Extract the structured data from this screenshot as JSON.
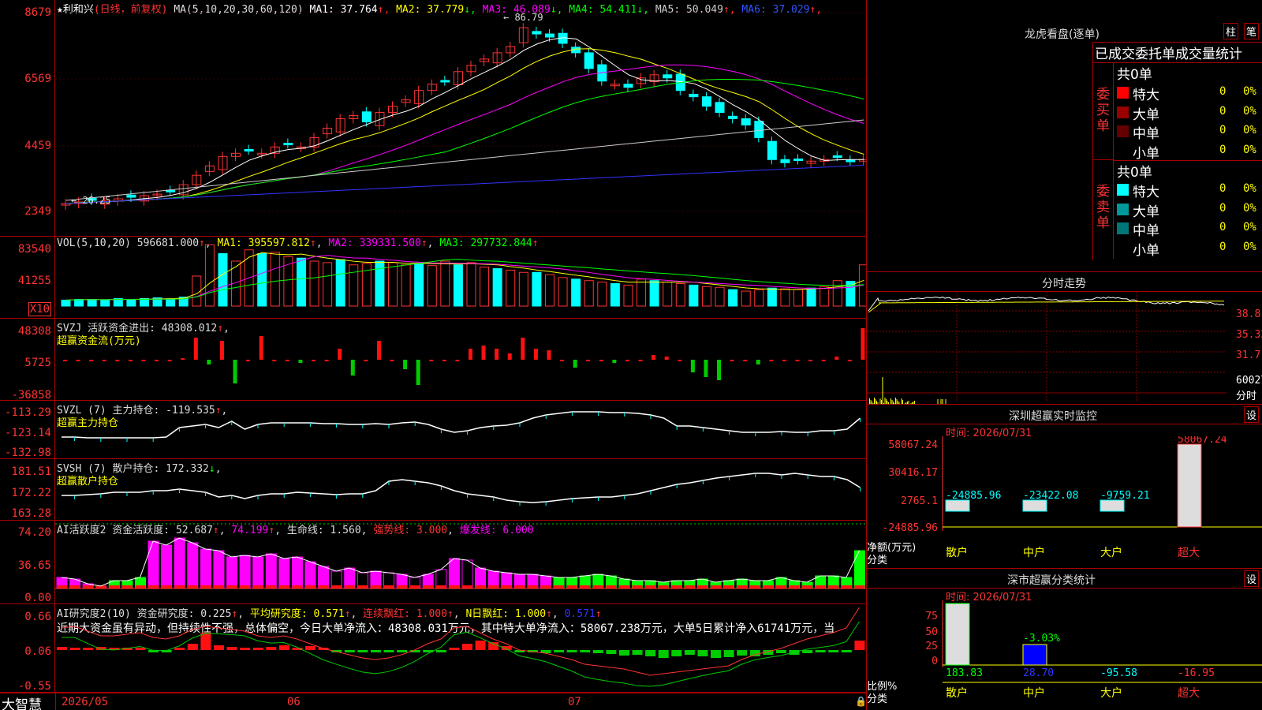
{
  "window": {
    "title": "大智慧",
    "stock_name": "利和兴",
    "adjust": "(日线，前复权)"
  },
  "main": {
    "ma_label": "MA(5,10,20,30,60,120)",
    "ma": [
      {
        "name": "MA1",
        "value": "37.764",
        "arrow": "↑",
        "color": "#ffffff"
      },
      {
        "name": "MA2",
        "value": "37.779",
        "arrow": "↓",
        "color": "#ffff00"
      },
      {
        "name": "MA3",
        "value": "46.089",
        "arrow": "↓",
        "color": "#ff00ff"
      },
      {
        "name": "MA4",
        "value": "54.411",
        "arrow": "↓",
        "color": "#00ff00"
      },
      {
        "name": "MA5",
        "value": "50.049",
        "arrow": "↑",
        "color": "#cccccc"
      },
      {
        "name": "MA6",
        "value": "37.029",
        "arrow": "↑",
        "color": "#3355ff"
      }
    ],
    "y_ticks": [
      "8679",
      "6569",
      "4459",
      "2349"
    ],
    "high_label": "86.79",
    "low_label": "26.25"
  },
  "vol": {
    "label": "VOL(5,10,20)",
    "value": "596681.000",
    "arrow": "↑",
    "ma1": "395597.812",
    "ma2": "339331.500",
    "ma3": "297732.844",
    "y_ticks": [
      "83540",
      "41255"
    ],
    "unit": "X10"
  },
  "svzj": {
    "label": "SVZJ  活跃资金进出: 48308.012",
    "sub": "超赢资金流(万元)",
    "y_ticks": [
      "48308",
      "5725",
      "-36858"
    ]
  },
  "svzl": {
    "label": "SVZL (7) 主力持仓: -119.535",
    "sub": "超赢主力持仓",
    "y_ticks": [
      "-113.29",
      "-123.14",
      "-132.98"
    ]
  },
  "svsh": {
    "label": "SVSH (7) 散户持仓: 172.332",
    "sub": "超赢散户持仓",
    "y_ticks": [
      "181.51",
      "172.22",
      "163.28"
    ]
  },
  "ai1": {
    "label": "AI活跃度2 资金活跃度: 52.687",
    "v2": "74.199",
    "life": "生命线: 1.560",
    "strong": "强势线: 3.000",
    "burst": "爆发线: 6.000",
    "y_ticks": [
      "74.20",
      "36.65",
      "0.00"
    ]
  },
  "ai2": {
    "label": "AI研究度2(10) 资金研究度: 0.225",
    "avg": "平均研究度: 0.571",
    "lian": "连续飘红: 1.000",
    "nday": "N日飘红: 1.000",
    "last": "0.571",
    "text": "近期大资金虽有异动，但持续性不强，总体偏空，今日大单净流入：48308.031万元，其中特大单净流入：58067.238万元，大单5日累计净入61741万元，当",
    "y_ticks": [
      "0.66",
      "0.06",
      "-0.55"
    ]
  },
  "dates": [
    "2026/05",
    "06",
    "07"
  ],
  "right": {
    "longhu": {
      "title": "龙虎看盘(逐单)",
      "btn1": "柱",
      "btn2": "笔",
      "sub": "已成交委托单成交量统计",
      "buy_title": "委买单",
      "sell_title": "委卖单",
      "buy_total": "共0单",
      "sell_total": "共0单",
      "buy": [
        {
          "label": "特大",
          "v": "0",
          "p": "0%",
          "c": "#ff0000"
        },
        {
          "label": "大单",
          "v": "0",
          "p": "0%",
          "c": "#990000"
        },
        {
          "label": "中单",
          "v": "0",
          "p": "0%",
          "c": "#660000"
        },
        {
          "label": "小单",
          "v": "0",
          "p": "0%",
          "c": "#000000"
        }
      ],
      "sell": [
        {
          "label": "特大",
          "v": "0",
          "p": "0%",
          "c": "#00ffff"
        },
        {
          "label": "大单",
          "v": "0",
          "p": "0%",
          "c": "#009999"
        },
        {
          "label": "中单",
          "v": "0",
          "p": "0%",
          "c": "#007777"
        },
        {
          "label": "小单",
          "v": "0",
          "p": "0%",
          "c": "#000000"
        }
      ]
    },
    "fenshi": {
      "title": "分时走势",
      "y_ticks": [
        "38.8",
        "35.32",
        "31.7"
      ],
      "vol_tick": "60027",
      "vol_label": "分时"
    },
    "monitor": {
      "title": "深圳超赢实时监控",
      "btn": "设",
      "time": "时间: 2026/07/31",
      "y_ticks": [
        "58067.24",
        "30416.17",
        "2765.1",
        "-24885.96"
      ],
      "ylabel": "净额(万元)",
      "xlabel": "分类",
      "cats": [
        "散户",
        "中户",
        "大户",
        "超大"
      ],
      "values": [
        "-24885.96",
        "-23422.08",
        "-9759.21",
        "58067.24"
      ]
    },
    "classify": {
      "title": "深市超赢分类统计",
      "btn": "设",
      "time": "时间: 2026/07/31",
      "y_ticks": [
        "75",
        "50",
        "25",
        "0"
      ],
      "ylabel": "比例%",
      "xlabel": "分类",
      "pct": "-3.03%",
      "cats": [
        "散户",
        "中户",
        "大户",
        "超大"
      ],
      "values": [
        "183.83",
        "28.70",
        "-95.58",
        "-16.95"
      ]
    }
  }
}
